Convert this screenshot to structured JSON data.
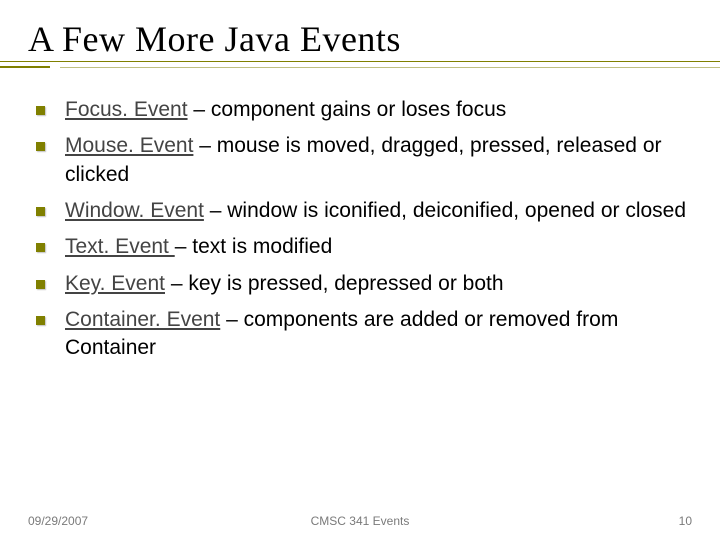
{
  "title": "A Few More Java Events",
  "items": [
    {
      "term": "Focus. Event",
      "desc": " – component gains or loses focus"
    },
    {
      "term": "Mouse. Event",
      "desc": " – mouse is moved, dragged, pressed, released or clicked"
    },
    {
      "term": "Window. Event",
      "desc": " – window is iconified, deiconified, opened or closed"
    },
    {
      "term": "Text. Event ",
      "desc": "– text is modified"
    },
    {
      "term": "Key. Event",
      "desc": " – key is pressed, depressed or both"
    },
    {
      "term": "Container. Event",
      "desc": " – components are added or removed from Container"
    }
  ],
  "footer": {
    "date": "09/29/2007",
    "center": "CMSC 341 Events",
    "page": "10"
  }
}
